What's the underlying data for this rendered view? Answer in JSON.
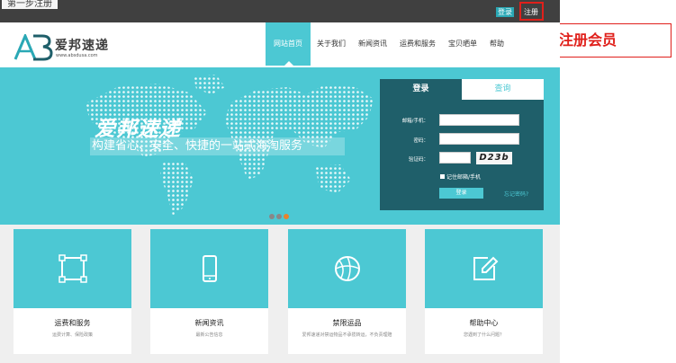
{
  "topbar": {
    "faint_text": "第一步注册",
    "login_label": "登录",
    "register_label": "注册"
  },
  "callout": {
    "text": "点此注册会员"
  },
  "logo": {
    "name": "爱邦速递",
    "url": "www.absdusa.com"
  },
  "nav": {
    "items": [
      {
        "label": "网站首页",
        "active": true
      },
      {
        "label": "关于我们"
      },
      {
        "label": "新闻资讯"
      },
      {
        "label": "运费和服务"
      },
      {
        "label": "宝贝晒单"
      },
      {
        "label": "帮助"
      }
    ]
  },
  "banner": {
    "title": "爱邦速递",
    "subtitle": "构建省心、安全、快捷的一站式海淘服务"
  },
  "login_panel": {
    "tab_login": "登录",
    "tab_query": "查询",
    "email_label": "邮箱/手机：",
    "password_label": "密码：",
    "captcha_label": "验证码：",
    "captcha_text": "D23b",
    "remember_label": "记住邮箱/手机",
    "submit_label": "登录",
    "forgot_label": "忘记密码?"
  },
  "cards": [
    {
      "title": "运费和服务",
      "desc": "运费计算、保险政策",
      "icon": "crop-frame-icon"
    },
    {
      "title": "新闻资讯",
      "desc": "最新公告信息",
      "icon": "phone-icon"
    },
    {
      "title": "禁限运品",
      "desc": "爱邦速递对禁运物品不承揽转运，不负责理赔",
      "icon": "ball-icon"
    },
    {
      "title": "帮助中心",
      "desc": "您遇到了什么问题？",
      "icon": "edit-icon"
    }
  ],
  "colors": {
    "accent": "#4cc8d3",
    "panel": "#1f5f6a",
    "highlight": "#e0201b",
    "topbar": "#404040"
  }
}
